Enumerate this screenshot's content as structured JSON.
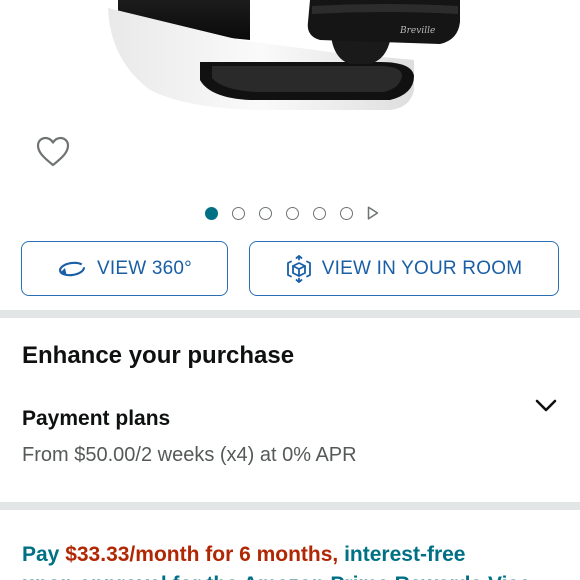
{
  "product": {
    "brand": "Breville",
    "image_icon": "coffee-machine-image"
  },
  "wishlist": {
    "icon": "heart-outline-icon"
  },
  "carousel": {
    "total_dots": 6,
    "active_index": 0,
    "has_video": true
  },
  "buttons": {
    "view_360": "VIEW 360°",
    "view_in_room": "VIEW IN YOUR ROOM"
  },
  "enhance": {
    "title": "Enhance your purchase"
  },
  "payment_plans": {
    "title": "Payment plans",
    "subtitle": "From $50.00/2 weeks (x4) at 0% APR"
  },
  "promo": {
    "prefix": "Pay ",
    "price": "$33.33/month for 6 months,",
    "suffix": " interest-free",
    "line2": "upon approval for the Amazon Prime Rewards Visa"
  },
  "colors": {
    "accent_teal": "#007185",
    "button_blue": "#1a5fa6",
    "price_red": "#b12704",
    "divider": "#e3e6e6"
  }
}
